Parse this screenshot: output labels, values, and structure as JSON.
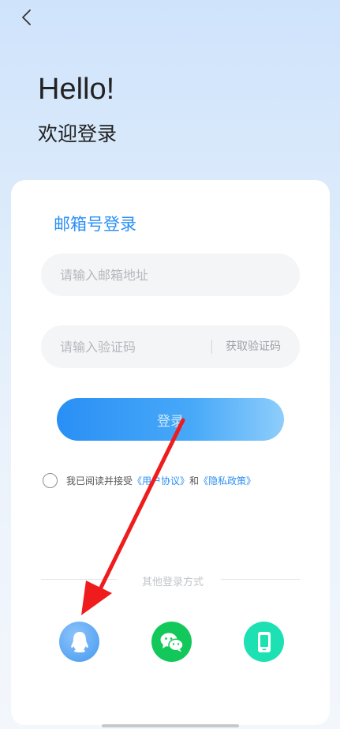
{
  "header": {
    "greeting": "Hello!",
    "welcome": "欢迎登录"
  },
  "card": {
    "title": "邮箱号登录",
    "email_placeholder": "请输入邮箱地址",
    "code_placeholder": "请输入验证码",
    "get_code_label": "获取验证码",
    "login_label": "登录",
    "agreement": {
      "prefix": "我已阅读并接受",
      "user_agreement": "《用户协议》",
      "and": "和",
      "privacy_policy": "《隐私政策》"
    },
    "other_login_label": "其他登录方式",
    "social_logins": [
      "qq-icon",
      "wechat-icon",
      "phone-icon"
    ]
  },
  "colors": {
    "accent": "#2a8ff5",
    "wechat": "#13c85a",
    "phone": "#1de0b3",
    "annotation_arrow": "#ee1c1c"
  }
}
